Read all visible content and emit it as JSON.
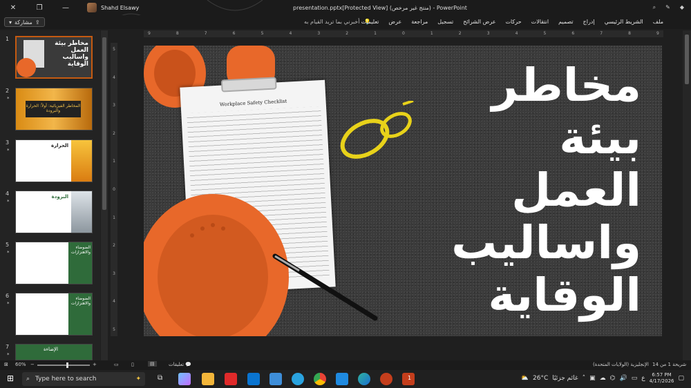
{
  "window": {
    "title": "presentation.pptx[Protected View] (منتج غير مرخص) - PowerPoint",
    "user_name": "Shahd Elsawy"
  },
  "ribbon": {
    "share_label": "مشاركة",
    "tellme": "أخبرني بما تريد القيام به",
    "tabs": [
      "ملف",
      "الشريط الرئيسي",
      "إدراج",
      "تصميم",
      "انتقالات",
      "حركات",
      "عرض الشرائح",
      "تسجيل",
      "مراجعة",
      "عرض",
      "تعليمات"
    ]
  },
  "ruler": {
    "top_ticks": [
      "9",
      "8",
      "7",
      "6",
      "5",
      "4",
      "3",
      "2",
      "1",
      "0",
      "1",
      "2",
      "3",
      "4",
      "5",
      "6",
      "7",
      "8",
      "9"
    ],
    "left_ticks": [
      "5",
      "4",
      "3",
      "2",
      "1",
      "0",
      "1",
      "2",
      "3",
      "4",
      "5"
    ]
  },
  "thumbnails": [
    {
      "num": "1",
      "star": "",
      "title": "مخاطر بيئة العمل واساليب الوقاية"
    },
    {
      "num": "2",
      "star": "*",
      "title": "المخاطر الفيزيائية: أولاً: الحرارة والبرودة"
    },
    {
      "num": "3",
      "star": "*",
      "title": "الحرارة"
    },
    {
      "num": "4",
      "star": "*",
      "title": "البرودة"
    },
    {
      "num": "5",
      "star": "*",
      "title": "الضوضاء والاهتزازات"
    },
    {
      "num": "6",
      "star": "*",
      "title": "الضوضاء والاهتزازات"
    },
    {
      "num": "7",
      "star": "*",
      "title": "الإضاءة"
    }
  ],
  "slide": {
    "title_lines": [
      "مخاطر",
      "بيئة",
      "العمل",
      "واساليب",
      "الوقاية"
    ],
    "checklist_title": "Workplace Safety Checklist"
  },
  "statusbar": {
    "slide_info": "شريحة 1 من 14",
    "language": "الإنجليزية (الولايات المتحدة)",
    "notes_label": "تعليقات",
    "zoom": "60%"
  },
  "taskbar": {
    "search_placeholder": "Type here to search",
    "temp": "26°C",
    "weather": "غائم جزئيًا",
    "lang": "ع",
    "time": "6:57 PM",
    "date": "4/17/2026",
    "badge": "1"
  },
  "colors": {
    "accent": "#c55a11",
    "background": "#1f1f1f"
  }
}
